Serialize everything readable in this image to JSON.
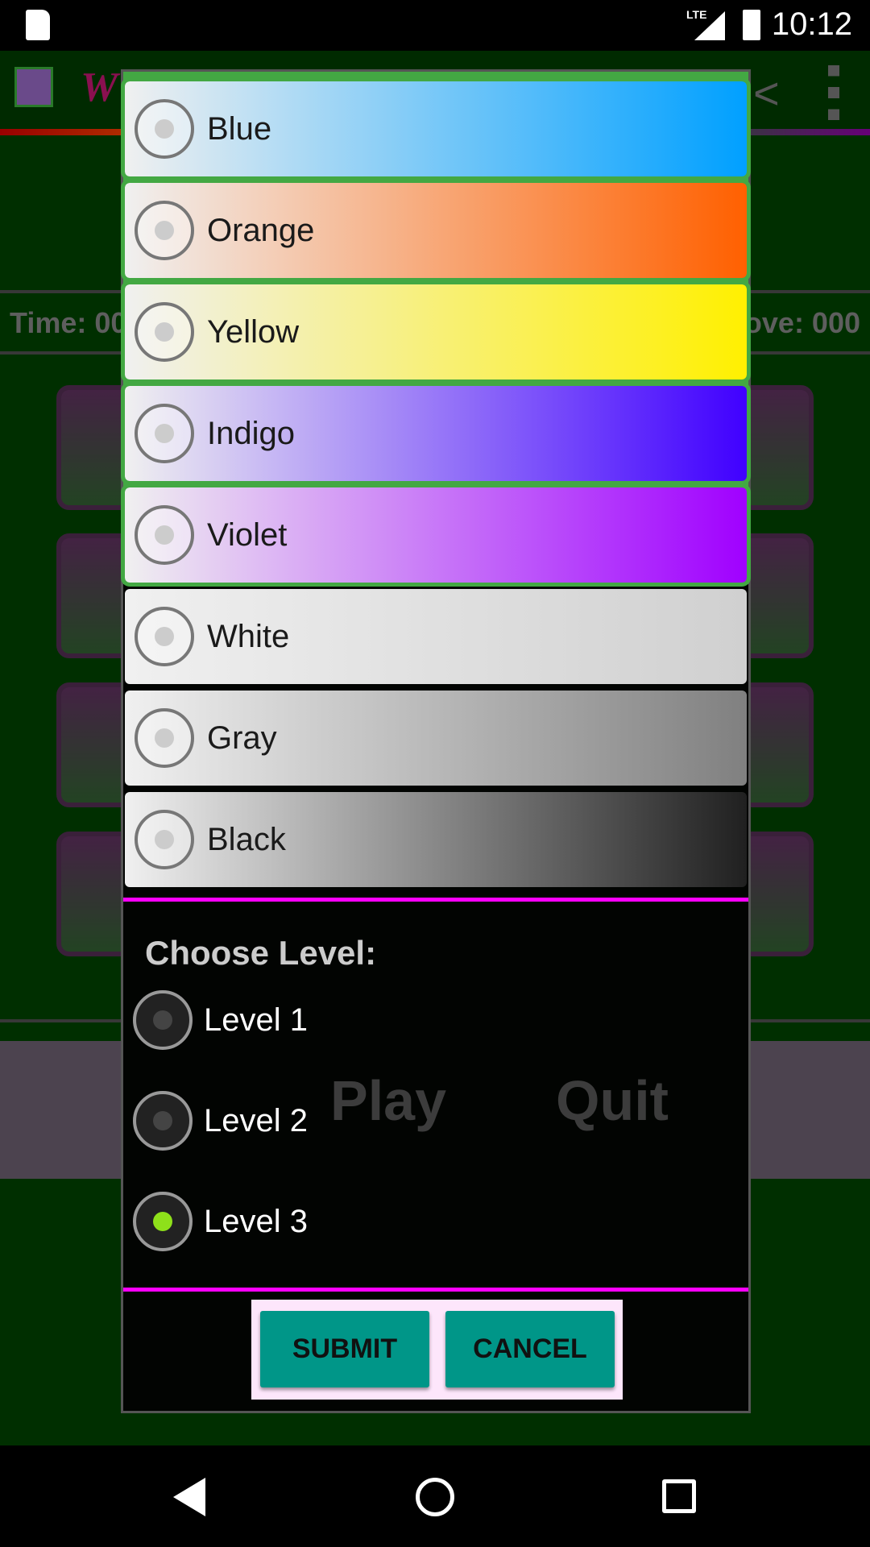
{
  "status_bar": {
    "time": "10:12",
    "network": "LTE",
    "icons": [
      "sd-card-icon",
      "signal-icon",
      "battery-charging-icon"
    ]
  },
  "background": {
    "time_label": "Time: 00",
    "move_label": "ove: 000",
    "play_label": "Play",
    "quit_label": "Quit"
  },
  "dialog": {
    "colors": [
      {
        "label": "Blue",
        "from": "#f0f0f0",
        "to": "#00a0ff",
        "selected": false
      },
      {
        "label": "Orange",
        "from": "#f0f0f0",
        "to": "#ff6000",
        "selected": false
      },
      {
        "label": "Yellow",
        "from": "#f0f0f0",
        "to": "#fff000",
        "selected": false
      },
      {
        "label": "Indigo",
        "from": "#f0f0f0",
        "to": "#4000ff",
        "selected": false
      },
      {
        "label": "Violet",
        "from": "#f0f0f0",
        "to": "#a000ff",
        "selected": false
      },
      {
        "label": "White",
        "from": "#f0f0f0",
        "to": "#d0d0d0",
        "selected": false
      },
      {
        "label": "Gray",
        "from": "#f0f0f0",
        "to": "#808080",
        "selected": false
      },
      {
        "label": "Black",
        "from": "#f0f0f0",
        "to": "#202020",
        "selected": false
      }
    ],
    "level_heading": "Choose Level:",
    "levels": [
      {
        "label": "Level 1",
        "selected": false
      },
      {
        "label": "Level 2",
        "selected": false
      },
      {
        "label": "Level 3",
        "selected": true
      }
    ],
    "submit_label": "SUBMIT",
    "cancel_label": "CANCEL",
    "accent": "#ff00ff",
    "selected_color": "#8ee01a"
  }
}
